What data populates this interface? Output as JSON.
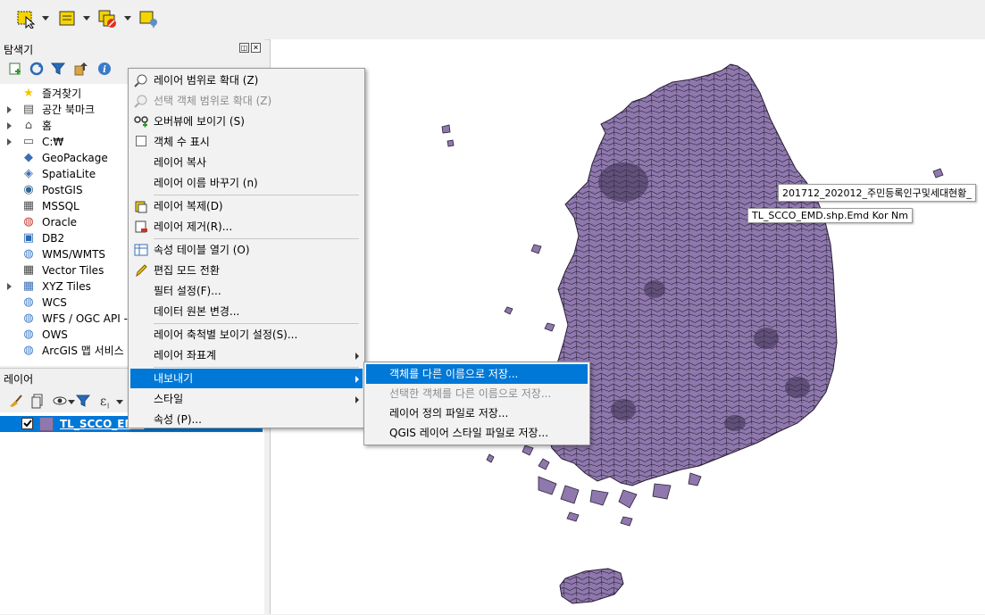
{
  "browser": {
    "title": "탐색기",
    "items": [
      {
        "label": "즐겨찾기",
        "icon": "star-icon",
        "expandable": false
      },
      {
        "label": "공간 북마크",
        "icon": "bookmark-icon",
        "expandable": true
      },
      {
        "label": "홈",
        "icon": "home-icon",
        "expandable": true
      },
      {
        "label": "C:₩",
        "icon": "drive-icon",
        "expandable": true
      },
      {
        "label": "GeoPackage",
        "icon": "geopackage-icon",
        "expandable": false
      },
      {
        "label": "SpatiaLite",
        "icon": "spatialite-icon",
        "expandable": false
      },
      {
        "label": "PostGIS",
        "icon": "postgis-icon",
        "expandable": false
      },
      {
        "label": "MSSQL",
        "icon": "mssql-icon",
        "expandable": false
      },
      {
        "label": "Oracle",
        "icon": "oracle-icon",
        "expandable": false
      },
      {
        "label": "DB2",
        "icon": "db2-icon",
        "expandable": false
      },
      {
        "label": "WMS/WMTS",
        "icon": "globe-icon",
        "expandable": false
      },
      {
        "label": "Vector Tiles",
        "icon": "vector-tiles-icon",
        "expandable": false
      },
      {
        "label": "XYZ Tiles",
        "icon": "xyz-tiles-icon",
        "expandable": true
      },
      {
        "label": "WCS",
        "icon": "globe-icon",
        "expandable": false
      },
      {
        "label": "WFS / OGC API -",
        "icon": "globe-icon",
        "expandable": false
      },
      {
        "label": "OWS",
        "icon": "globe-icon",
        "expandable": false
      },
      {
        "label": "ArcGIS 맵 서비스",
        "icon": "globe-icon",
        "expandable": false
      }
    ]
  },
  "layers": {
    "title": "레이어",
    "items": [
      {
        "label": "TL_SCCO_EMD",
        "checked": true,
        "color": "#8e78ad"
      }
    ]
  },
  "context_menu": {
    "items": [
      {
        "label": "레이어 범위로 확대 (Z)",
        "icon": "zoom-layer-icon",
        "disabled": false
      },
      {
        "label": "선택 객체 범위로 확대 (Z)",
        "icon": "zoom-selection-icon",
        "disabled": true
      },
      {
        "label": "오버뷰에 보이기 (S)",
        "icon": "overview-icon",
        "disabled": false
      },
      {
        "label": "객체 수 표시",
        "icon": "checkbox-icon",
        "disabled": false
      },
      {
        "label": "레이어 복사",
        "icon": "",
        "disabled": false
      },
      {
        "label": "레이어 이름 바꾸기 (n)",
        "icon": "",
        "disabled": false
      },
      {
        "label": "레이어 복제(D)",
        "icon": "duplicate-layer-icon",
        "disabled": false
      },
      {
        "label": "레이어 제거(R)...",
        "icon": "remove-layer-icon",
        "disabled": false
      },
      {
        "label": "속성 테이블 열기 (O)",
        "icon": "attribute-table-icon",
        "disabled": false
      },
      {
        "label": "편집 모드 전환",
        "icon": "pencil-icon",
        "disabled": false
      },
      {
        "label": "필터 설정(F)...",
        "icon": "",
        "disabled": false
      },
      {
        "label": "데이터 원본 변경...",
        "icon": "",
        "disabled": false
      },
      {
        "label": "레이어 축척별 보이기 설정(S)...",
        "icon": "",
        "disabled": false
      },
      {
        "label": "레이어 좌표계",
        "icon": "",
        "disabled": false,
        "submenu": true
      },
      {
        "label": "내보내기",
        "icon": "",
        "disabled": false,
        "submenu": true,
        "highlighted": true
      },
      {
        "label": "스타일",
        "icon": "",
        "disabled": false,
        "submenu": true
      },
      {
        "label": "속성 (P)...",
        "icon": "",
        "disabled": false
      }
    ]
  },
  "export_submenu": {
    "items": [
      {
        "label": "객체를 다른 이름으로 저장...",
        "disabled": false,
        "highlighted": true
      },
      {
        "label": "선택한 객체를 다른 이름으로 저장...",
        "disabled": true
      },
      {
        "label": "레이어 정의 파일로 저장...",
        "disabled": false
      },
      {
        "label": "QGIS 레이어 스타일 파일로 저장...",
        "disabled": false
      }
    ]
  },
  "map": {
    "tooltips": [
      "201712_202012_주민등록인구및세대현황_",
      "TL_SCCO_EMD.shp.Emd Kor Nm"
    ],
    "fill_color": "#8e78ad"
  }
}
